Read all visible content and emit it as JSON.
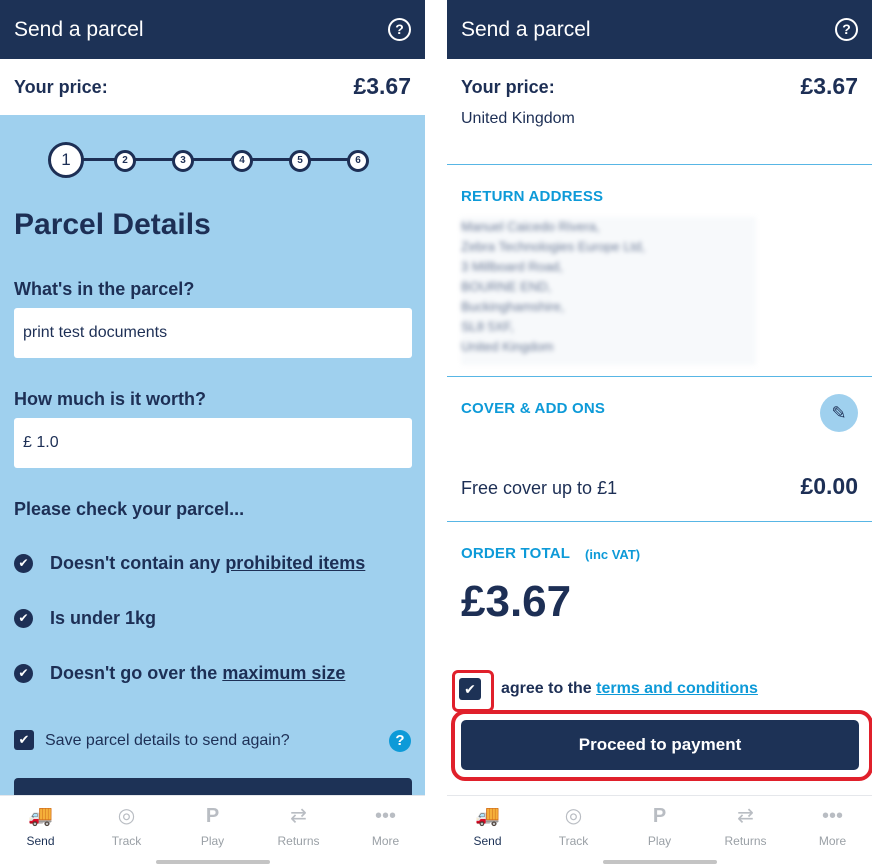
{
  "app": {
    "title": "Send a parcel",
    "help_icon": "?",
    "price_label": "Your price:",
    "price_value": "£3.67"
  },
  "left": {
    "steps": [
      "1",
      "2",
      "3",
      "4",
      "5",
      "6"
    ],
    "current_step": 1,
    "section_title": "Parcel Details",
    "contents_label": "What's in the parcel?",
    "contents_value": "print test documents",
    "worth_label": "How much is it worth?",
    "worth_value": "£ 1.0",
    "check_heading": "Please check your parcel...",
    "checks": [
      {
        "text": "Doesn't contain any ",
        "link": "prohibited items"
      },
      {
        "text": "Is under 1kg",
        "link": ""
      },
      {
        "text": "Doesn't go over the ",
        "link": "maximum size"
      }
    ],
    "save_label": "Save parcel details to send again?",
    "save_help": "?"
  },
  "right": {
    "cut_text": "United Kingdom",
    "return_heading": "RETURN ADDRESS",
    "return_address": [
      "Manuel Caicedo Rivera,",
      "Zebra Technologies Europe Ltd,",
      "3 Millboard Road,",
      "BOURNE END,",
      "Buckinghamshire,",
      "SL8 5XF,",
      "United Kingdom"
    ],
    "cover_heading": "COVER & ADD ONS",
    "cover_label": "Free cover up to £1",
    "cover_value": "£0.00",
    "order_heading": "ORDER TOTAL",
    "vat_label": "(inc VAT)",
    "order_total": "£3.67",
    "agree_text": "agree to the ",
    "agree_link": "terms and conditions",
    "pay_button": "Proceed to payment",
    "highlight_color": "#e0202b"
  },
  "nav": [
    {
      "label": "Send",
      "icon": "van-icon"
    },
    {
      "label": "Track",
      "icon": "target-icon"
    },
    {
      "label": "Play",
      "icon": "play-icon"
    },
    {
      "label": "Returns",
      "icon": "returns-icon"
    },
    {
      "label": "More",
      "icon": "more-icon"
    }
  ],
  "colors": {
    "navy": "#1d3256",
    "light_blue": "#9fd0ee",
    "accent": "#0d9ad8"
  }
}
